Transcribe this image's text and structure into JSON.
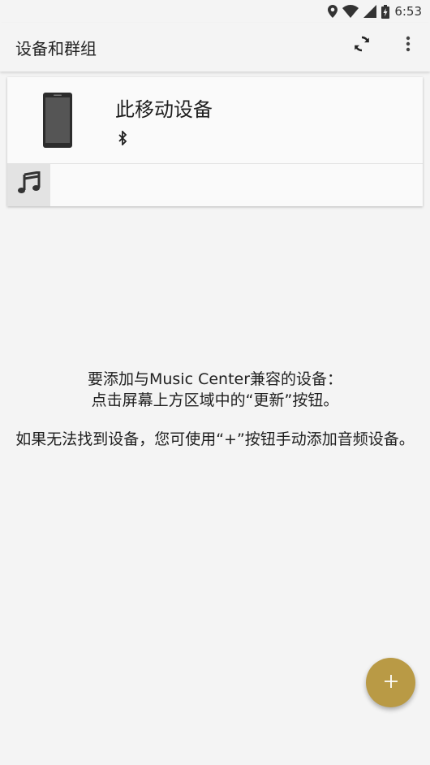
{
  "status_bar": {
    "time": "6:53",
    "icons": [
      "location-icon",
      "wifi-icon",
      "signal-icon",
      "battery-charging-icon"
    ]
  },
  "app_bar": {
    "title": "设备和群组",
    "actions": [
      "refresh-icon",
      "more-vert-icon"
    ]
  },
  "device_card": {
    "name": "此移动设备",
    "connection_icon": "bluetooth-icon",
    "device_icon": "phone-icon",
    "source_icon": "music-note-icon"
  },
  "hint": {
    "line1": "要添加与Music Center兼容的设备：",
    "line2": "点击屏幕上方区域中的“更新”按钮。",
    "line3": "如果无法找到设备，您可使用“+”按钮手动添加音频设备。"
  },
  "fab": {
    "icon": "add-icon",
    "color": "#b99a45"
  },
  "colors": {
    "background": "#f4f4f4",
    "card": "#fafafa",
    "accent": "#b99a45"
  }
}
